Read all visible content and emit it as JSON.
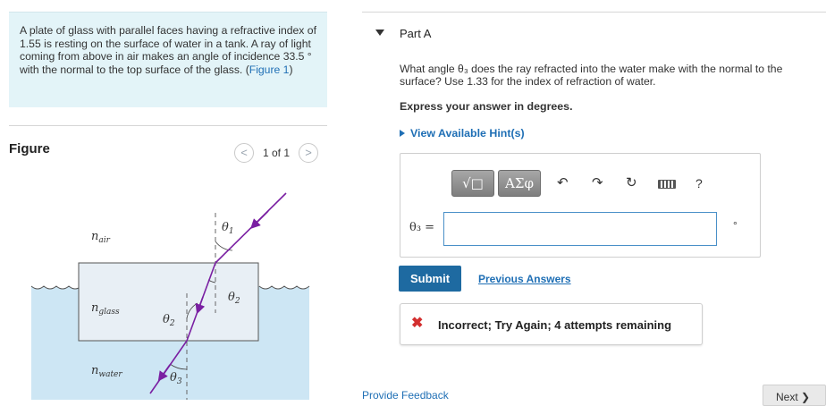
{
  "problem": {
    "text": "A plate of glass with parallel faces having a refractive index of 1.55 is resting on the surface of water in a tank. A ray of light coming from above in air makes an angle of incidence 33.5 ° with the normal to the top surface of the glass. (",
    "figure_link": "Figure 1",
    "text_end": ")"
  },
  "figure": {
    "title": "Figure",
    "pager_text": "1 of 1",
    "prev_glyph": "<",
    "next_glyph": ">",
    "labels": {
      "n_air": "n",
      "n_air_sub": "air",
      "n_glass": "n",
      "n_glass_sub": "glass",
      "n_water": "n",
      "n_water_sub": "water",
      "theta1": "θ",
      "theta1_sub": "1",
      "theta2_top": "θ",
      "theta2_top_sub": "2",
      "theta2_left": "θ",
      "theta2_left_sub": "2",
      "theta3": "θ",
      "theta3_sub": "3"
    },
    "colors": {
      "water": "#cde6f4",
      "glass": "#e8eff5",
      "ray": "#7a1fa2",
      "arrow": "#7a1fa2"
    }
  },
  "part": {
    "title": "Part A",
    "question": "What angle θ₃ does the ray refracted into the water make with the normal to the surface? Use 1.33 for the index of refraction of water.",
    "instruction": "Express your answer in degrees.",
    "hints_label": "View Available Hint(s)"
  },
  "toolbar": {
    "templates_label": "√□",
    "symbols_label": "ΑΣφ",
    "undo_glyph": "↶",
    "redo_glyph": "↷",
    "reset_glyph": "↻",
    "help_glyph": "?"
  },
  "answer": {
    "variable_label": "θ₃ =",
    "value": "",
    "unit": "°"
  },
  "actions": {
    "submit_label": "Submit",
    "previous_answers_label": "Previous Answers"
  },
  "feedback": {
    "icon": "✖",
    "message": "Incorrect; Try Again; 4 attempts remaining"
  },
  "footer": {
    "provide_feedback": "Provide Feedback",
    "next_label": "Next ❯"
  }
}
